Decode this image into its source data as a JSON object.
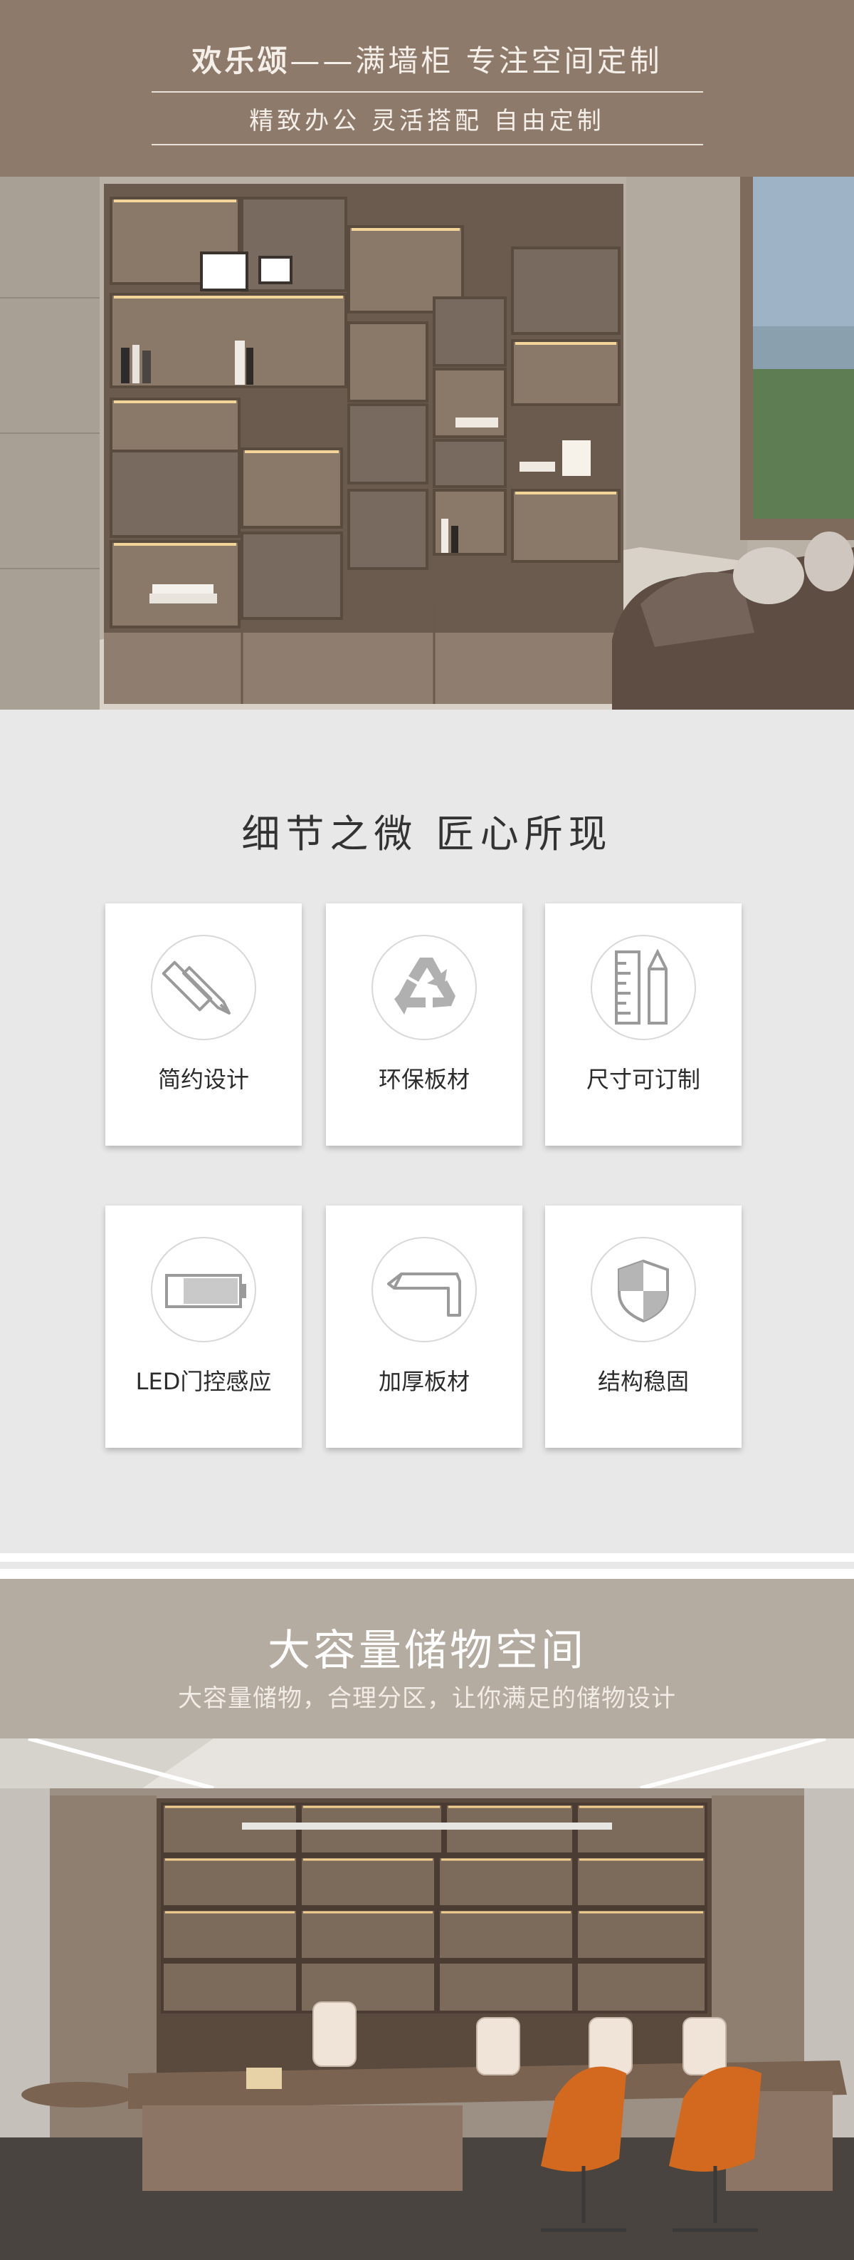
{
  "header": {
    "title_brand": "欢乐颂",
    "title_rest": "——满墙柜  专注空间定制",
    "subtitle": "精致办公  灵活搭配  自由定制",
    "bg_color": "#8d7a6b"
  },
  "details": {
    "heading": "细节之微  匠心所现",
    "features": [
      {
        "label": "简约设计",
        "icon": "ruler-pencil-icon"
      },
      {
        "label": "环保板材",
        "icon": "recycle-icon"
      },
      {
        "label": "尺寸可订制",
        "icon": "ruler-pen-icon"
      },
      {
        "label": "LED门控感应",
        "icon": "battery-icon"
      },
      {
        "label": "加厚板材",
        "icon": "board-icon"
      },
      {
        "label": "结构稳固",
        "icon": "shield-icon"
      }
    ]
  },
  "storage": {
    "title": "大容量储物空间",
    "subtitle": "大容量储物，合理分区，让你满足的储物设计",
    "bg_color": "#b5aca1"
  }
}
